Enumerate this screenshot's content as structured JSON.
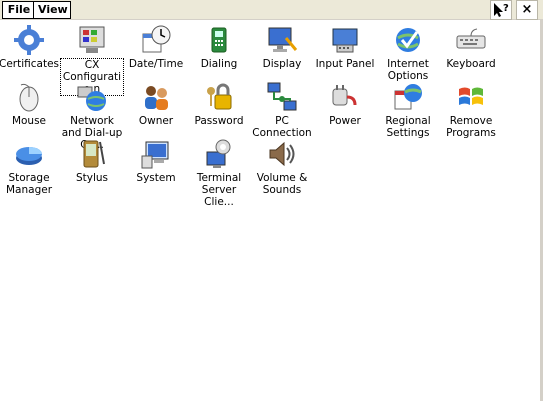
{
  "menu": {
    "file": "File",
    "view": "View"
  },
  "toolbar": {
    "help_glyph": "?",
    "close_glyph": "×"
  },
  "icons": [
    {
      "label": "Certificates",
      "icon": "gear-icon"
    },
    {
      "label": "CX Configuratio n",
      "icon": "cx-config-icon"
    },
    {
      "label": "Date/Time",
      "icon": "clock-calendar-icon"
    },
    {
      "label": "Dialing",
      "icon": "phone-icon"
    },
    {
      "label": "Display",
      "icon": "monitor-brush-icon"
    },
    {
      "label": "Input Panel",
      "icon": "input-panel-icon"
    },
    {
      "label": "Internet Options",
      "icon": "globe-check-icon"
    },
    {
      "label": "Keyboard",
      "icon": "keyboard-icon"
    },
    {
      "label": "Mouse",
      "icon": "mouse-icon"
    },
    {
      "label": "Network and Dial-up Co...",
      "icon": "network-globe-icon"
    },
    {
      "label": "Owner",
      "icon": "owner-people-icon"
    },
    {
      "label": "Password",
      "icon": "keys-lock-icon"
    },
    {
      "label": "PC Connection",
      "icon": "pc-connection-icon"
    },
    {
      "label": "Power",
      "icon": "power-plug-icon"
    },
    {
      "label": "Regional Settings",
      "icon": "regional-globe-icon"
    },
    {
      "label": "Remove Programs",
      "icon": "windows-flag-icon"
    },
    {
      "label": "Storage Manager",
      "icon": "storage-pie-icon"
    },
    {
      "label": "Stylus",
      "icon": "stylus-pda-icon"
    },
    {
      "label": "System",
      "icon": "system-monitor-icon"
    },
    {
      "label": "Terminal Server Clie...",
      "icon": "terminal-server-icon"
    },
    {
      "label": "Volume & Sounds",
      "icon": "speaker-icon"
    }
  ]
}
